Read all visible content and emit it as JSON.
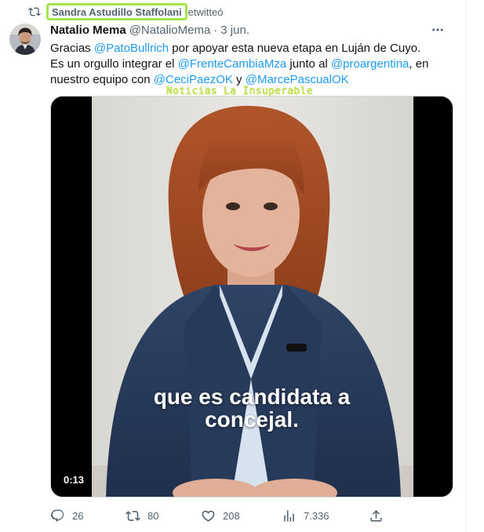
{
  "retweet": {
    "retweeter_name": "Sandra Astudillo Staffolani",
    "suffix": "etwitteó",
    "highlight_color": "#a4e34a"
  },
  "tweet": {
    "author_name": "Natalio Mema",
    "author_handle": "@NatalioMema",
    "separator": "·",
    "date": "3 jun.",
    "more_icon": "more-horizontal-icon",
    "text": {
      "l1_a": "Gracias ",
      "l1_mention": "@PatoBullrich",
      "l1_b": " por apoyar esta nueva etapa en Luján de Cuyo.",
      "l2_a": "Es un orgullo integrar el ",
      "l2_mention1": "@FrenteCambiaMza",
      "l2_b": " junto al ",
      "l2_mention2": "@proargentina",
      "l2_c": ", en",
      "l3_a": "nuestro equipo con ",
      "l3_mention1": "@CeciPaezOK",
      "l3_b": " y ",
      "l3_mention2": "@MarcePascualOK"
    }
  },
  "media": {
    "watermark": "Noticias La Insuperable",
    "caption_line1": "que es candidata a",
    "caption_line2": "concejal.",
    "duration": "0:13"
  },
  "actions": {
    "replies": "26",
    "retweets": "80",
    "likes": "208",
    "views": "7.336"
  },
  "colors": {
    "link": "#1d9bf0",
    "secondary_text": "#536471",
    "primary_text": "#0f1419"
  }
}
